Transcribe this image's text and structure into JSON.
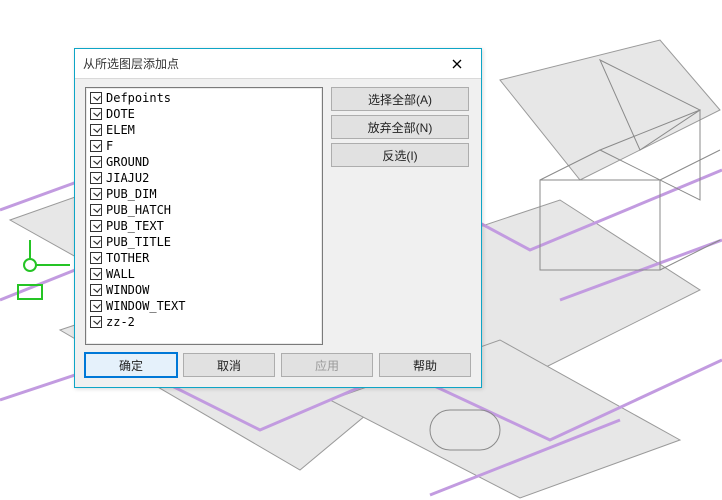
{
  "dialog": {
    "title": "从所选图层添加点",
    "layers": [
      {
        "name": "Defpoints",
        "checked": true
      },
      {
        "name": "DOTE",
        "checked": true
      },
      {
        "name": "ELEM",
        "checked": true
      },
      {
        "name": "F",
        "checked": true
      },
      {
        "name": "GROUND",
        "checked": true
      },
      {
        "name": "JIAJU2",
        "checked": true
      },
      {
        "name": "PUB_DIM",
        "checked": true
      },
      {
        "name": "PUB_HATCH",
        "checked": true
      },
      {
        "name": "PUB_TEXT",
        "checked": true
      },
      {
        "name": "PUB_TITLE",
        "checked": true
      },
      {
        "name": "TOTHER",
        "checked": true
      },
      {
        "name": "WALL",
        "checked": true
      },
      {
        "name": "WINDOW",
        "checked": true
      },
      {
        "name": "WINDOW_TEXT",
        "checked": true
      },
      {
        "name": "zz-2",
        "checked": true
      }
    ],
    "side_buttons": {
      "select_all": "选择全部(A)",
      "clear_all": "放弃全部(N)",
      "invert": "反选(I)"
    },
    "bottom_buttons": {
      "ok": "确定",
      "cancel": "取消",
      "apply": "应用",
      "help": "帮助"
    }
  },
  "colors": {
    "dialog_border": "#0ea5c6",
    "default_button": "#0078d7"
  }
}
